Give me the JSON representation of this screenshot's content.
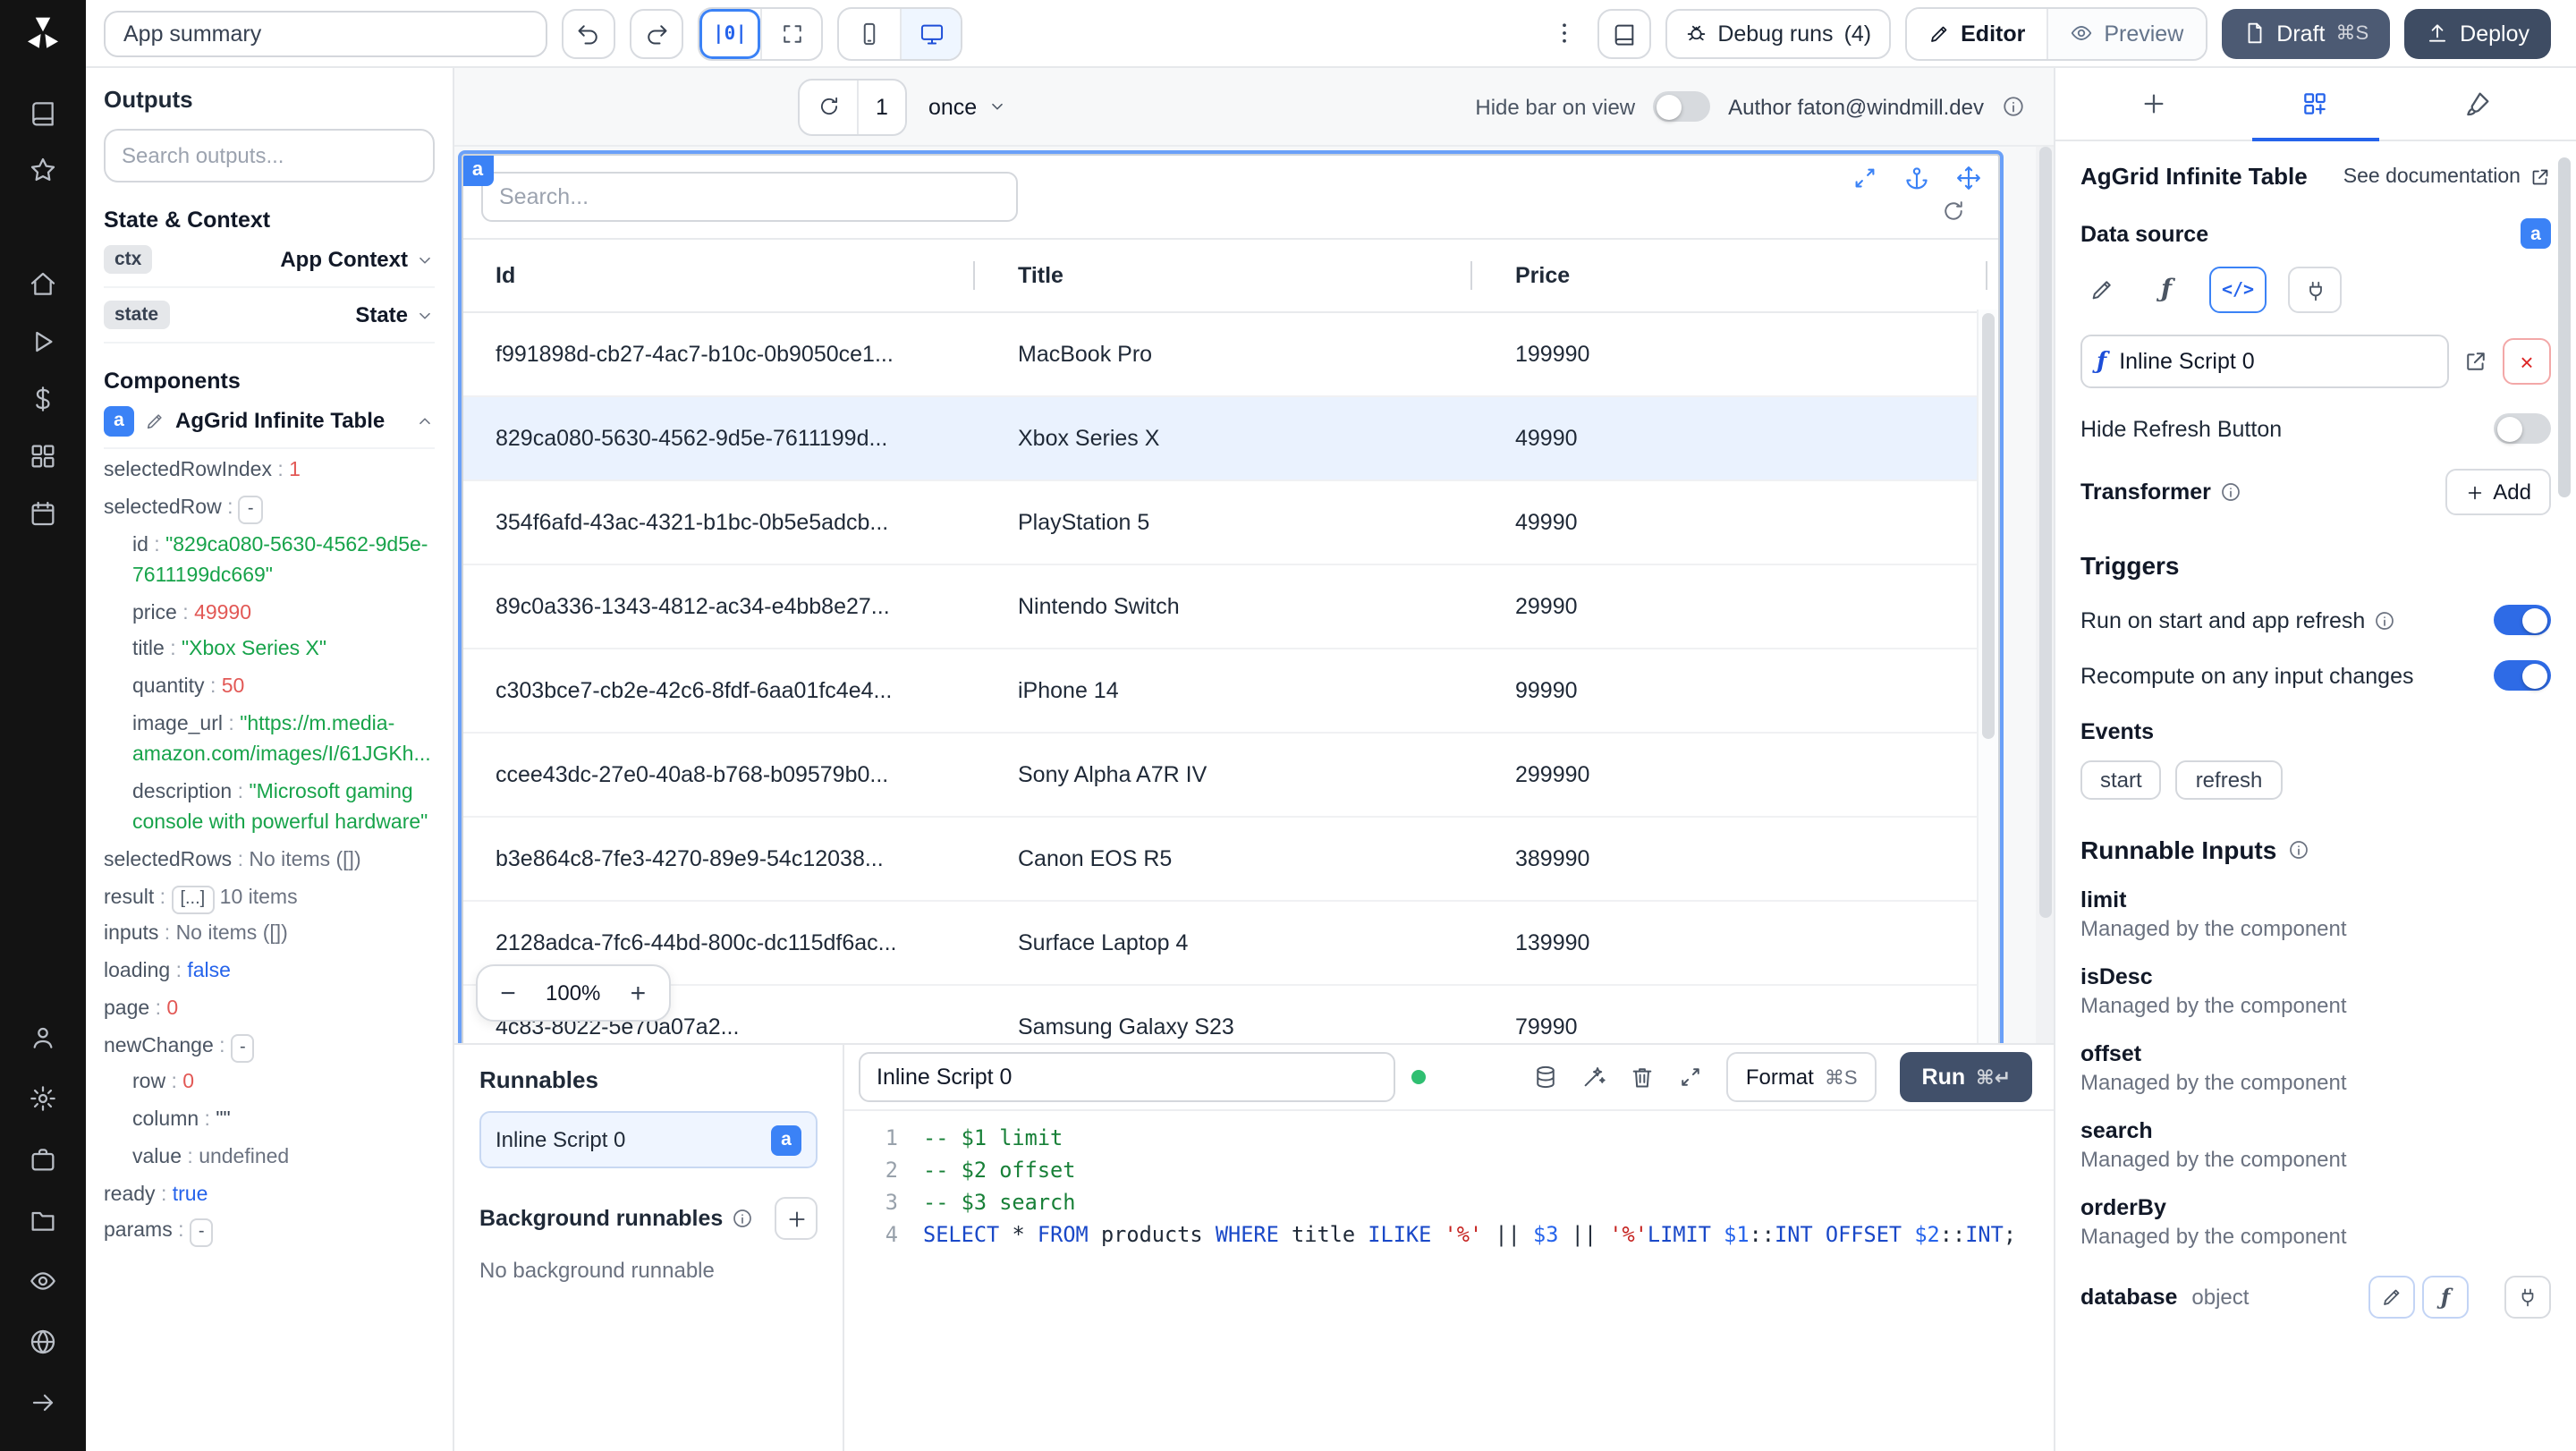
{
  "topbar": {
    "app_summary": "App summary",
    "grid_glyph": "|0|",
    "debug_runs_label": "Debug runs",
    "debug_runs_count": "(4)",
    "editor_label": "Editor",
    "preview_label": "Preview",
    "draft_label": "Draft",
    "draft_shortcut": "⌘S",
    "deploy_label": "Deploy"
  },
  "rail": {
    "groups": [
      [
        "book",
        "star"
      ],
      [
        "home",
        "play",
        "dollar",
        "blocks",
        "calendar"
      ]
    ],
    "bottom": [
      "user",
      "gear",
      "box",
      "folder",
      "eye",
      "globe",
      "arrow-right"
    ]
  },
  "outputs": {
    "title": "Outputs",
    "search_placeholder": "Search outputs...",
    "state_context_title": "State & Context",
    "ctx_badge": "ctx",
    "ctx_label": "App Context",
    "state_badge": "state",
    "state_label": "State",
    "components_title": "Components",
    "component_badge": "a",
    "component_name": "AgGrid Infinite Table",
    "tree": [
      {
        "k": "selectedRowIndex",
        "v": "1",
        "t": "num",
        "i": 0
      },
      {
        "k": "selectedRow",
        "v": "-",
        "t": "chip",
        "i": 0
      },
      {
        "k": "id",
        "v": "\"829ca080-5630-4562-9d5e-7611199dc669\"",
        "t": "str",
        "i": 1
      },
      {
        "k": "price",
        "v": "49990",
        "t": "num",
        "i": 1
      },
      {
        "k": "title",
        "v": "\"Xbox Series X\"",
        "t": "str",
        "i": 1
      },
      {
        "k": "quantity",
        "v": "50",
        "t": "num",
        "i": 1
      },
      {
        "k": "image_url",
        "v": "\"https://m.media-amazon.com/images/I/61JGKh...",
        "t": "str",
        "i": 1
      },
      {
        "k": "description",
        "v": "\"Microsoft gaming console with powerful hardware\"",
        "t": "str",
        "i": 1
      },
      {
        "k": "selectedRows",
        "v": "No items ([])",
        "t": "muted",
        "i": 0
      },
      {
        "k": "result",
        "v": "[...]",
        "t": "chip",
        "extra": "10 items",
        "i": 0
      },
      {
        "k": "inputs",
        "v": "No items ([])",
        "t": "muted",
        "i": 0
      },
      {
        "k": "loading",
        "v": "false",
        "t": "bool",
        "i": 0
      },
      {
        "k": "page",
        "v": "0",
        "t": "num",
        "i": 0
      },
      {
        "k": "newChange",
        "v": "-",
        "t": "chip",
        "i": 0
      },
      {
        "k": "row",
        "v": "0",
        "t": "num",
        "i": 1
      },
      {
        "k": "column",
        "v": "\"\"",
        "t": "plain",
        "i": 1
      },
      {
        "k": "value",
        "v": "undefined",
        "t": "muted",
        "i": 1
      },
      {
        "k": "ready",
        "v": "true",
        "t": "bool",
        "i": 0
      },
      {
        "k": "params",
        "v": "-",
        "t": "chip",
        "i": 0
      }
    ]
  },
  "canvas": {
    "refresh_count": "1",
    "frequency": "once",
    "hide_bar_label": "Hide bar on view",
    "author": "Author faton@windmill.dev",
    "component_tag": "a",
    "search_placeholder": "Search...",
    "zoom_out": "−",
    "zoom_label": "100%",
    "zoom_in": "+"
  },
  "grid": {
    "columns": [
      "Id",
      "Title",
      "Price"
    ],
    "selected_index": 1,
    "rows": [
      [
        "f991898d-cb27-4ac7-b10c-0b9050ce1...",
        "MacBook Pro",
        "199990"
      ],
      [
        "829ca080-5630-4562-9d5e-7611199d...",
        "Xbox Series X",
        "49990"
      ],
      [
        "354f6afd-43ac-4321-b1bc-0b5e5adcb...",
        "PlayStation 5",
        "49990"
      ],
      [
        "89c0a336-1343-4812-ac34-e4bb8e27...",
        "Nintendo Switch",
        "29990"
      ],
      [
        "c303bce7-cb2e-42c6-8fdf-6aa01fc4e4...",
        "iPhone 14",
        "99990"
      ],
      [
        "ccee43dc-27e0-40a8-b768-b09579b0...",
        "Sony Alpha A7R IV",
        "299990"
      ],
      [
        "b3e864c8-7fe3-4270-89e9-54c12038...",
        "Canon EOS R5",
        "389990"
      ],
      [
        "2128adca-7fc6-44bd-800c-dc115df6ac...",
        "Surface Laptop 4",
        "139990"
      ],
      [
        "4c83-8022-5e70a07a2...",
        "Samsung Galaxy S23",
        "79990"
      ]
    ]
  },
  "runnables": {
    "title": "Runnables",
    "item_label": "Inline Script 0",
    "item_badge": "a",
    "background_title": "Background runnables",
    "background_empty": "No background runnable"
  },
  "code": {
    "name": "Inline Script 0",
    "format_label": "Format",
    "format_shortcut": "⌘S",
    "run_label": "Run",
    "run_shortcut": "⌘↵",
    "lines": [
      [
        {
          "t": "-- $1 limit",
          "c": "cm"
        }
      ],
      [
        {
          "t": "-- $2 offset",
          "c": "cm"
        }
      ],
      [
        {
          "t": "-- $3 search",
          "c": "cm"
        }
      ],
      [
        {
          "t": "SELECT",
          "c": "kw"
        },
        {
          "t": " ",
          "c": "pl"
        },
        {
          "t": "*",
          "c": "op"
        },
        {
          "t": " ",
          "c": "pl"
        },
        {
          "t": "FROM",
          "c": "kw"
        },
        {
          "t": " products ",
          "c": "pl"
        },
        {
          "t": "WHERE",
          "c": "kw"
        },
        {
          "t": " title ",
          "c": "pl"
        },
        {
          "t": "ILIKE",
          "c": "kw"
        },
        {
          "t": " ",
          "c": "pl"
        },
        {
          "t": "'%'",
          "c": "str"
        },
        {
          "t": " || ",
          "c": "pl"
        },
        {
          "t": "$3",
          "c": "var"
        },
        {
          "t": " || ",
          "c": "pl"
        },
        {
          "t": "'%'",
          "c": "str"
        },
        {
          "t": "LIMIT",
          "c": "kw"
        },
        {
          "t": " ",
          "c": "pl"
        },
        {
          "t": "$1",
          "c": "var"
        },
        {
          "t": "::",
          "c": "pl"
        },
        {
          "t": "INT",
          "c": "kw"
        },
        {
          "t": " ",
          "c": "pl"
        },
        {
          "t": "OFFSET",
          "c": "kw"
        },
        {
          "t": " ",
          "c": "pl"
        },
        {
          "t": "$2",
          "c": "var"
        },
        {
          "t": "::",
          "c": "pl"
        },
        {
          "t": "INT",
          "c": "kw"
        },
        {
          "t": ";",
          "c": "pl"
        }
      ]
    ]
  },
  "panel": {
    "title": "AgGrid Infinite Table",
    "doc_link": "See documentation",
    "data_source_label": "Data source",
    "badge": "a",
    "code_glyph": "</>",
    "script_name": "Inline Script 0",
    "hide_refresh_label": "Hide Refresh Button",
    "transformer_label": "Transformer",
    "add_label": "Add",
    "triggers_title": "Triggers",
    "toggle_rows": [
      {
        "label": "Run on start and app refresh",
        "on": true
      },
      {
        "label": "Recompute on any input changes",
        "on": true
      }
    ],
    "events_label": "Events",
    "events": [
      "start",
      "refresh"
    ],
    "runnable_inputs_title": "Runnable Inputs",
    "inputs": [
      {
        "name": "limit",
        "note": "Managed by the component"
      },
      {
        "name": "isDesc",
        "note": "Managed by the component"
      },
      {
        "name": "offset",
        "note": "Managed by the component"
      },
      {
        "name": "search",
        "note": "Managed by the component"
      },
      {
        "name": "orderBy",
        "note": "Managed by the component"
      }
    ],
    "database_name": "database",
    "database_type": "object"
  }
}
